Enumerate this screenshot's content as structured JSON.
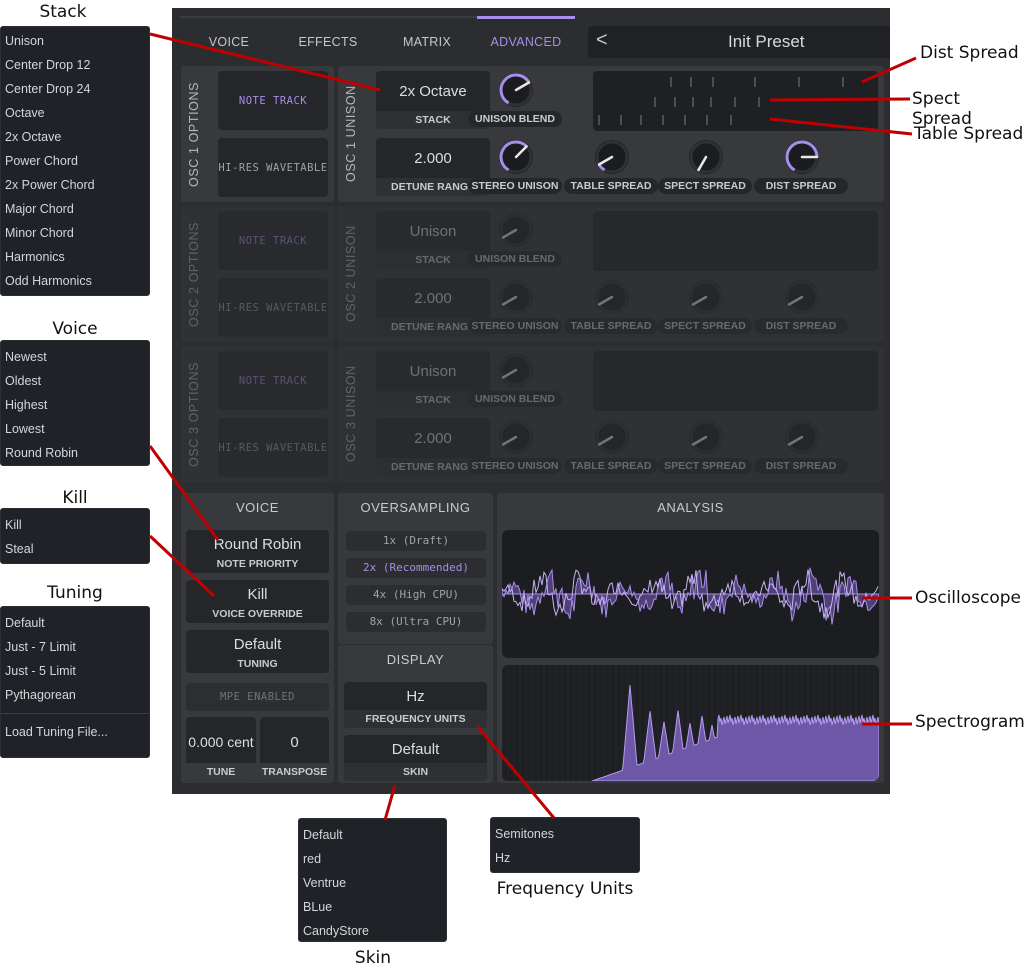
{
  "annotations": {
    "stack": "Stack",
    "voice": "Voice",
    "kill": "Kill",
    "tuning": "Tuning",
    "dist_spread": "Dist Spread",
    "spect_spread": "Spect Spread",
    "table_spread": "Table Spread",
    "oscilloscope": "Oscilloscope",
    "spectrogram": "Spectrogram",
    "frequency_units": "Frequency Units",
    "skin": "Skin"
  },
  "menus": {
    "stack": [
      "Unison",
      "Center Drop 12",
      "Center Drop 24",
      "Octave",
      "2x Octave",
      "Power Chord",
      "2x Power Chord",
      "Major Chord",
      "Minor Chord",
      "Harmonics",
      "Odd Harmonics"
    ],
    "voice": [
      "Newest",
      "Oldest",
      "Highest",
      "Lowest",
      "Round Robin"
    ],
    "kill": [
      "Kill",
      "Steal"
    ],
    "tuning": [
      "Default",
      "Just - 7 Limit",
      "Just - 5 Limit",
      "Pythagorean"
    ],
    "tuning_extra": "Load Tuning File...",
    "skin": [
      "Default",
      "red",
      "Ventrue",
      "BLue",
      "CandyStore"
    ],
    "frequency_units": [
      "Semitones",
      "Hz"
    ]
  },
  "tabs": [
    "VOICE",
    "EFFECTS",
    "MATRIX",
    "ADVANCED"
  ],
  "active_tab": "ADVANCED",
  "preset": {
    "chevron": "<",
    "name": "Init Preset"
  },
  "osc": [
    {
      "options_label": "OSC 1 OPTIONS",
      "unison_label": "OSC 1 UNISON",
      "note_track": "NOTE TRACK",
      "hires": "HI-RES WAVETABLE",
      "stack_value": "2x Octave",
      "stack_label": "STACK",
      "detune_value": "2.000",
      "detune_label": "DETUNE RANGE",
      "knobs": {
        "unison_blend": "UNISON BLEND",
        "stereo_unison": "STEREO UNISON",
        "table_spread": "TABLE SPREAD",
        "spect_spread": "SPECT SPREAD",
        "dist_spread": "DIST SPREAD"
      }
    },
    {
      "options_label": "OSC 2 OPTIONS",
      "unison_label": "OSC 2 UNISON",
      "note_track": "NOTE TRACK",
      "hires": "HI-RES WAVETABLE",
      "stack_value": "Unison",
      "stack_label": "STACK",
      "detune_value": "2.000",
      "detune_label": "DETUNE RANGE",
      "knobs": {
        "unison_blend": "UNISON BLEND",
        "stereo_unison": "STEREO UNISON",
        "table_spread": "TABLE SPREAD",
        "spect_spread": "SPECT SPREAD",
        "dist_spread": "DIST SPREAD"
      }
    },
    {
      "options_label": "OSC 3 OPTIONS",
      "unison_label": "OSC 3 UNISON",
      "note_track": "NOTE TRACK",
      "hires": "HI-RES WAVETABLE",
      "stack_value": "Unison",
      "stack_label": "STACK",
      "detune_value": "2.000",
      "detune_label": "DETUNE RANGE",
      "knobs": {
        "unison_blend": "UNISON BLEND",
        "stereo_unison": "STEREO UNISON",
        "table_spread": "TABLE SPREAD",
        "spect_spread": "SPECT SPREAD",
        "dist_spread": "DIST SPREAD"
      }
    }
  ],
  "voice_section": {
    "title": "VOICE",
    "note_priority": {
      "value": "Round Robin",
      "label": "NOTE PRIORITY"
    },
    "voice_override": {
      "value": "Kill",
      "label": "VOICE OVERRIDE"
    },
    "tuning": {
      "value": "Default",
      "label": "TUNING"
    },
    "mpe": "MPE ENABLED",
    "tune": {
      "value": "0.000 cent",
      "label": "TUNE"
    },
    "transpose": {
      "value": "0",
      "label": "TRANSPOSE"
    }
  },
  "oversampling": {
    "title": "OVERSAMPLING",
    "options": [
      "1x (Draft)",
      "2x (Recommended)",
      "4x (High CPU)",
      "8x (Ultra CPU)"
    ],
    "selected": "2x (Recommended)"
  },
  "display": {
    "title": "DISPLAY",
    "frequency_units": {
      "value": "Hz",
      "label": "FREQUENCY UNITS"
    },
    "skin": {
      "value": "Default",
      "label": "SKIN"
    }
  },
  "analysis": {
    "title": "ANALYSIS"
  },
  "colors": {
    "accent": "#a88ee8",
    "annotation_line": "#c00000",
    "panel": "#37393c",
    "background": "#2b2d30"
  }
}
